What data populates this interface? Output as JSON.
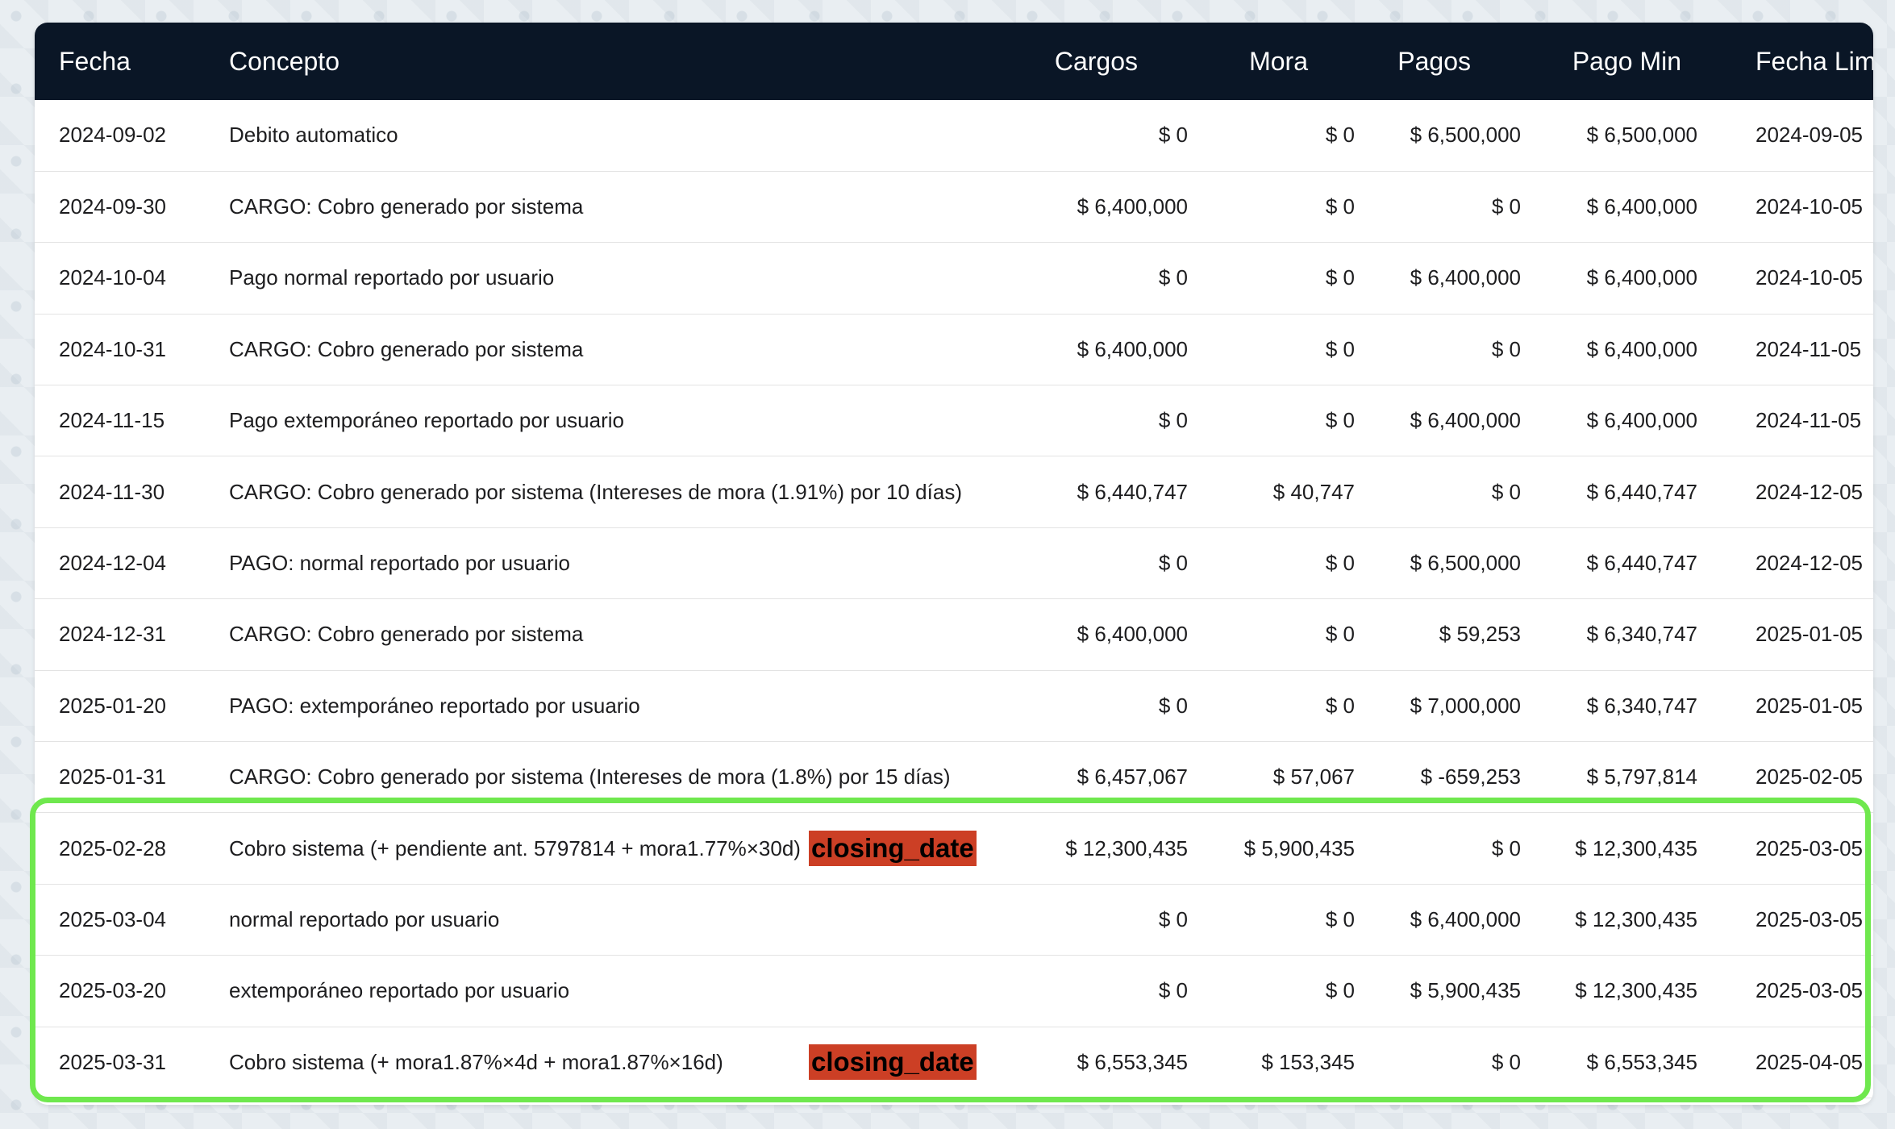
{
  "table": {
    "headers": {
      "fecha": "Fecha",
      "concepto": "Concepto",
      "cargos": "Cargos",
      "mora": "Mora",
      "pagos": "Pagos",
      "pago_min": "Pago Min",
      "fecha_limite": "Fecha Limite"
    },
    "rows": [
      {
        "fecha": "2024-09-02",
        "concepto": "Debito automatico",
        "cargos": "$ 0",
        "mora": "$ 0",
        "pagos": "$ 6,500,000",
        "pago_min": "$ 6,500,000",
        "fecha_limite": "2024-09-05",
        "tag": ""
      },
      {
        "fecha": "2024-09-30",
        "concepto": "CARGO: Cobro generado por sistema",
        "cargos": "$ 6,400,000",
        "mora": "$ 0",
        "pagos": "$ 0",
        "pago_min": "$ 6,400,000",
        "fecha_limite": "2024-10-05",
        "tag": ""
      },
      {
        "fecha": "2024-10-04",
        "concepto": "Pago normal reportado por usuario",
        "cargos": "$ 0",
        "mora": "$ 0",
        "pagos": "$ 6,400,000",
        "pago_min": "$ 6,400,000",
        "fecha_limite": "2024-10-05",
        "tag": ""
      },
      {
        "fecha": "2024-10-31",
        "concepto": "CARGO: Cobro generado por sistema",
        "cargos": "$ 6,400,000",
        "mora": "$ 0",
        "pagos": "$ 0",
        "pago_min": "$ 6,400,000",
        "fecha_limite": "2024-11-05",
        "tag": ""
      },
      {
        "fecha": "2024-11-15",
        "concepto": "Pago extemporáneo reportado por usuario",
        "cargos": "$ 0",
        "mora": "$ 0",
        "pagos": "$ 6,400,000",
        "pago_min": "$ 6,400,000",
        "fecha_limite": "2024-11-05",
        "tag": ""
      },
      {
        "fecha": "2024-11-30",
        "concepto": "CARGO: Cobro generado por sistema (Intereses de mora (1.91%) por 10 días)",
        "cargos": "$ 6,440,747",
        "mora": "$ 40,747",
        "pagos": "$ 0",
        "pago_min": "$ 6,440,747",
        "fecha_limite": "2024-12-05",
        "tag": ""
      },
      {
        "fecha": "2024-12-04",
        "concepto": "PAGO: normal reportado por usuario",
        "cargos": "$ 0",
        "mora": "$ 0",
        "pagos": "$ 6,500,000",
        "pago_min": "$ 6,440,747",
        "fecha_limite": "2024-12-05",
        "tag": ""
      },
      {
        "fecha": "2024-12-31",
        "concepto": "CARGO: Cobro generado por sistema",
        "cargos": "$ 6,400,000",
        "mora": "$ 0",
        "pagos": "$ 59,253",
        "pago_min": "$ 6,340,747",
        "fecha_limite": "2025-01-05",
        "tag": ""
      },
      {
        "fecha": "2025-01-20",
        "concepto": "PAGO: extemporáneo reportado por usuario",
        "cargos": "$ 0",
        "mora": "$ 0",
        "pagos": "$ 7,000,000",
        "pago_min": "$ 6,340,747",
        "fecha_limite": "2025-01-05",
        "tag": ""
      },
      {
        "fecha": "2025-01-31",
        "concepto": "CARGO: Cobro generado por sistema (Intereses de mora (1.8%) por 15 días)",
        "cargos": "$ 6,457,067",
        "mora": "$ 57,067",
        "pagos": "$ -659,253",
        "pago_min": "$ 5,797,814",
        "fecha_limite": "2025-02-05",
        "tag": ""
      },
      {
        "fecha": "2025-02-28",
        "concepto": "Cobro sistema (+ pendiente ant. 5797814 + mora1.77%×30d)",
        "cargos": "$ 12,300,435",
        "mora": "$ 5,900,435",
        "pagos": "$ 0",
        "pago_min": "$ 12,300,435",
        "fecha_limite": "2025-03-05",
        "tag": "closing_date"
      },
      {
        "fecha": "2025-03-04",
        "concepto": "normal reportado por usuario",
        "cargos": "$ 0",
        "mora": "$ 0",
        "pagos": "$ 6,400,000",
        "pago_min": "$ 12,300,435",
        "fecha_limite": "2025-03-05",
        "tag": ""
      },
      {
        "fecha": "2025-03-20",
        "concepto": "extemporáneo reportado por usuario",
        "cargos": "$ 0",
        "mora": "$ 0",
        "pagos": "$ 5,900,435",
        "pago_min": "$ 12,300,435",
        "fecha_limite": "2025-03-05",
        "tag": ""
      },
      {
        "fecha": "2025-03-31",
        "concepto": "Cobro sistema (+ mora1.87%×4d + mora1.87%×16d)",
        "cargos": "$ 6,553,345",
        "mora": "$ 153,345",
        "pagos": "$ 0",
        "pago_min": "$ 6,553,345",
        "fecha_limite": "2025-04-05",
        "tag": "closing_date"
      }
    ]
  },
  "colors": {
    "header_bg": "#0a1626",
    "highlight_border": "#6fe84e",
    "tag_bg": "#cc3f25"
  }
}
